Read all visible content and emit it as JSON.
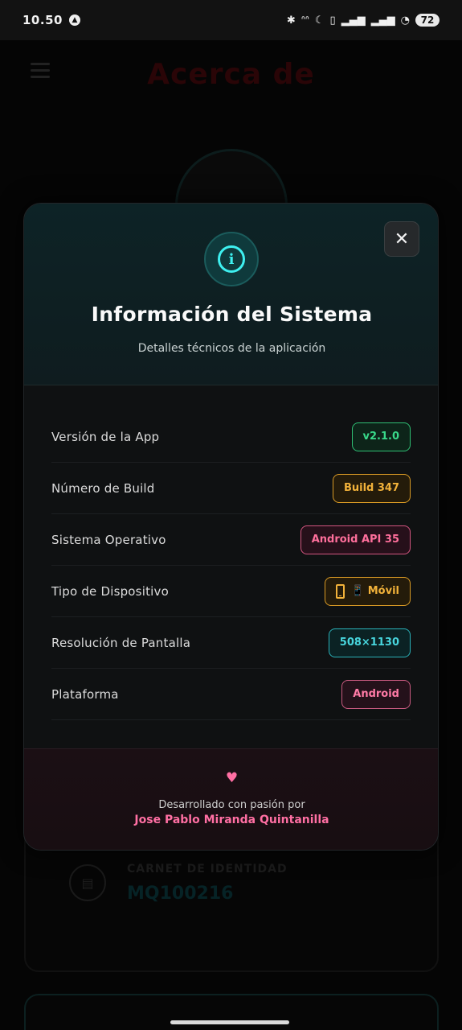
{
  "status_bar": {
    "time": "10.50",
    "battery": "72"
  },
  "background": {
    "title": "Acerca de",
    "card_label": "CARNET DE IDENTIDAD",
    "card_value": "MQ100216"
  },
  "modal": {
    "close_label": "✕",
    "title": "Información del Sistema",
    "subtitle": "Detalles técnicos de la aplicación",
    "rows": [
      {
        "label": "Versión de la App",
        "value": "v2.1.0",
        "color": "#39d98a"
      },
      {
        "label": "Número de Build",
        "value": "Build 347",
        "color": "#f2b23a"
      },
      {
        "label": "Sistema Operativo",
        "value": "Android API 35",
        "color": "#ff6f9c"
      },
      {
        "label": "Tipo de Dispositivo",
        "value": "📱 Móvil",
        "color": "#f2b23a"
      },
      {
        "label": "Resolución de Pantalla",
        "value": "508×1130",
        "color": "#48d6de"
      },
      {
        "label": "Plataforma",
        "value": "Android",
        "color": "#ff7aa6"
      }
    ],
    "footer": {
      "text": "Desarrollado con pasión por",
      "author": "Jose Pablo Miranda Quintanilla"
    }
  }
}
